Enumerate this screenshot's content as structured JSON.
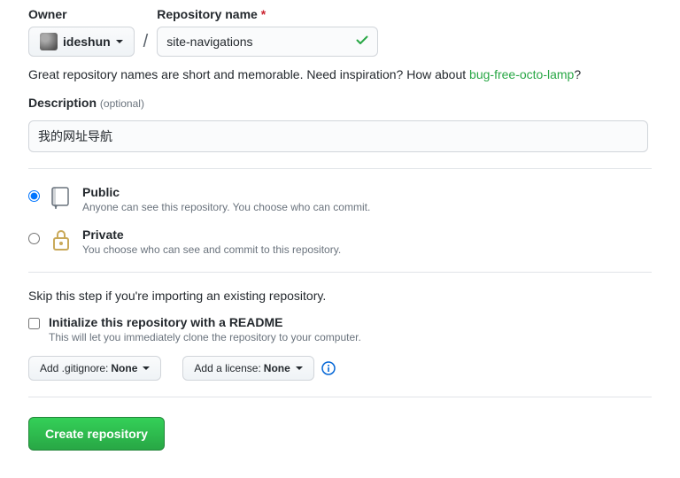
{
  "owner": {
    "label": "Owner",
    "value": "ideshun"
  },
  "repo": {
    "label": "Repository name",
    "required": "*",
    "value": "site-navigations"
  },
  "hint": {
    "prefix": "Great repository names are short and memorable. Need inspiration? How about ",
    "suggestion": "bug-free-octo-lamp",
    "suffix": "?"
  },
  "description": {
    "label": "Description",
    "optional": "(optional)",
    "value": "我的网址导航"
  },
  "visibility": {
    "public": {
      "title": "Public",
      "sub": "Anyone can see this repository. You choose who can commit."
    },
    "private": {
      "title": "Private",
      "sub": "You choose who can see and commit to this repository."
    }
  },
  "skip_hint": "Skip this step if you're importing an existing repository.",
  "init": {
    "title": "Initialize this repository with a README",
    "sub": "This will let you immediately clone the repository to your computer."
  },
  "options": {
    "gitignore_prefix": "Add .gitignore:",
    "gitignore_value": "None",
    "license_prefix": "Add a license:",
    "license_value": "None"
  },
  "submit": "Create repository"
}
